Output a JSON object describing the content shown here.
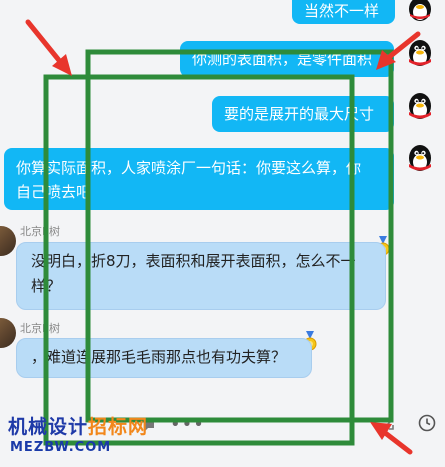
{
  "messages_out": [
    {
      "text": "当然不一样"
    },
    {
      "text": "你测的表面积，是零件面积"
    },
    {
      "text": "要的是展开的最大尺寸"
    },
    {
      "line1": "你算实际面积，人家喷涂厂一句话：你要这么算，你",
      "line2": "自己喷去吧"
    }
  ],
  "messages_in": [
    {
      "sender": "北京E树",
      "line1": "没明白，折8刀，表面积和展开表面积，怎么不一",
      "line2": "样？"
    },
    {
      "sender": "北京E树",
      "text": "，难道连展那毛毛雨那点也有功夫算？"
    }
  ],
  "toolbar": {
    "more_icon": "ellipsis-icon",
    "clock_icon": "clock-icon"
  },
  "watermark": {
    "part1": "机械设计",
    "part2": "招标网",
    "url": "MEZBW.COM"
  },
  "colors": {
    "outgoing_bubble": "#12b7f5",
    "incoming_bubble": "#b9dcf7",
    "annotation_green": "#2e8b3a",
    "annotation_red": "#e8352c"
  }
}
